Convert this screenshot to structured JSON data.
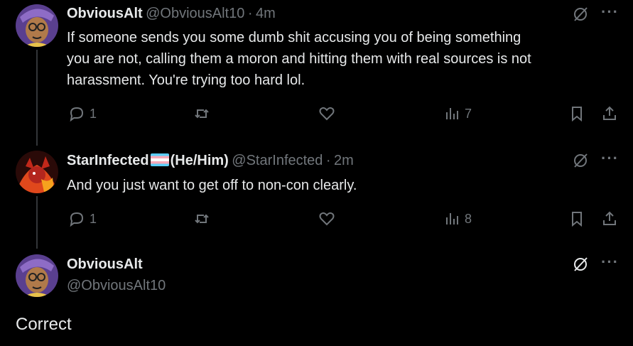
{
  "tweets": [
    {
      "name": "ObviousAlt",
      "handle": "@ObviousAlt10",
      "sep": "·",
      "time": "4m",
      "text_lines": [
        "If someone sends you some dumb shit accusing you of being something",
        "you are not, calling them a moron and hitting them with real sources is not",
        "harassment. You're trying too hard lol."
      ],
      "replies": "1",
      "views": "7"
    },
    {
      "name": "StarInfected",
      "pronouns": "(He/Him)",
      "handle": "@StarInfected",
      "sep": "·",
      "time": "2m",
      "text": "And you just want to get off to non-con clearly.",
      "replies": "1",
      "views": "8"
    }
  ],
  "main": {
    "name": "ObviousAlt",
    "handle": "@ObviousAlt10",
    "text": "Correct"
  },
  "icons": {
    "reply": "reply-icon",
    "retweet": "retweet-icon",
    "like": "heart-icon",
    "views": "views-icon",
    "bookmark": "bookmark-icon",
    "share": "share-icon",
    "grok": "grok-icon",
    "more": "more-icon"
  },
  "colors": {
    "background": "#000000",
    "text": "#e7e9ea",
    "muted": "#71767b"
  }
}
